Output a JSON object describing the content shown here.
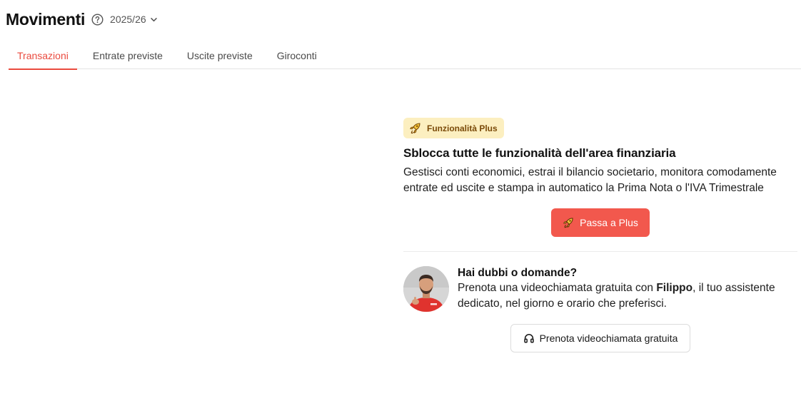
{
  "header": {
    "title": "Movimenti",
    "help_icon": "question-circle-icon",
    "year": "2025/26",
    "year_icon": "chevron-down-icon"
  },
  "tabs": [
    {
      "label": "Transazioni",
      "active": true
    },
    {
      "label": "Entrate previste",
      "active": false
    },
    {
      "label": "Uscite previste",
      "active": false
    },
    {
      "label": "Giroconti",
      "active": false
    }
  ],
  "promo": {
    "badge_icon": "rocket-icon",
    "badge_label": "Funzionalità Plus",
    "title": "Sblocca tutte le funzionalità dell'area finanziaria",
    "text": "Gestisci conti economici, estrai il bilancio societario, monitora comodamente entrate ed uscite e stampa in automatico la Prima Nota o l'IVA Trimestrale",
    "button_label": "Passa a Plus",
    "button_icon": "rocket-icon"
  },
  "assistant": {
    "title": "Hai dubbi o domande?",
    "text_before": "Prenota una videochiamata gratuita con ",
    "name": "Filippo",
    "text_after": ", il tuo assistente dedicato, nel giorno e orario che preferisci.",
    "button_label": "Prenota videochiamata gratuita",
    "button_icon": "headphones-icon"
  },
  "colors": {
    "accent": "#ea4a3e",
    "plus_button": "#f2584d",
    "badge_bg": "#fcefc0",
    "badge_text": "#7a4a08"
  }
}
